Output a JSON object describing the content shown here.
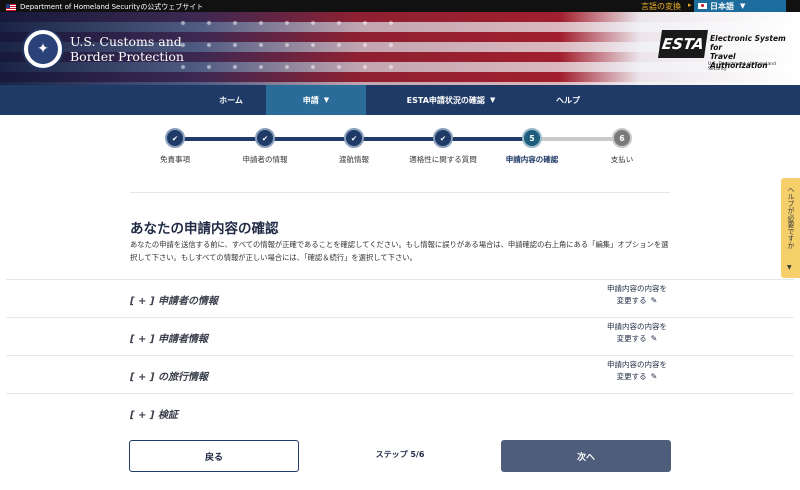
{
  "topbar": {
    "gov_label": "Department of Homeland Securityの公式ウェブサイト",
    "lang_change": "言語の変換",
    "lang_arrow": "▸",
    "lang_selected": "日本語",
    "caret": "▼"
  },
  "header": {
    "agency_line1": "U.S. Customs and",
    "agency_line2": "Border Protection",
    "esta_mark": "ESTA",
    "esta_line1": "Electronic System for",
    "esta_line2": "Travel Authorization",
    "esta_sub": "U.S. Department of Homeland Security"
  },
  "nav": {
    "home": "ホーム",
    "apply": "申請",
    "status": "ESTA申請状況の確認",
    "help": "ヘルプ",
    "caret": "▼"
  },
  "stepper": {
    "check": "✔",
    "steps": [
      {
        "label": "免責事項",
        "state": "done"
      },
      {
        "label": "申請者の情報",
        "state": "done"
      },
      {
        "label": "渡航情報",
        "state": "done"
      },
      {
        "label": "適格性に関する質問",
        "state": "done"
      },
      {
        "label": "申請内容の確認",
        "state": "current",
        "number": "5"
      },
      {
        "label": "支払い",
        "state": "future",
        "number": "6"
      }
    ]
  },
  "help_tab": {
    "label": "ヘルプが必要ですか",
    "caret": "▼"
  },
  "main": {
    "title": "あなたの申請内容の確認",
    "intro": "あなたの申請を送信する前に、すべての情報が正確であることを確認してください。もし情報に誤りがある場合は、申請確認の右上角にある「編集」オプションを選択して下さい。もしすべての情報が正しい場合には、「確認＆続行」を選択して下さい。",
    "sections": [
      {
        "title": "[ + ] 申請者の情報",
        "edit_line1": "申請内容の内容を",
        "edit_line2": "変更する"
      },
      {
        "title": "[ + ] 申請者情報",
        "edit_line1": "申請内容の内容を",
        "edit_line2": "変更する"
      },
      {
        "title": "[ + ] の旅行情報",
        "edit_line1": "申請内容の内容を",
        "edit_line2": "変更する"
      },
      {
        "title": "[ + ] 検証"
      }
    ],
    "pencil": "✎"
  },
  "footer": {
    "back": "戻る",
    "step_count": "ステップ 5/6",
    "next": "次へ"
  }
}
